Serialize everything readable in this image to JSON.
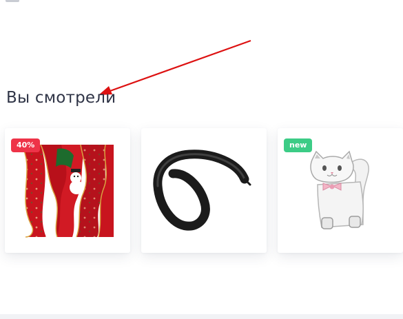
{
  "section": {
    "title": "Вы смотрели"
  },
  "products": [
    {
      "image": "red-christmas-ribbon",
      "badge": "40%",
      "badge_color": "#ee3348"
    },
    {
      "image": "black-modelling-balloon",
      "badge": null
    },
    {
      "image": "white-cat-gift-box",
      "badge": "new",
      "badge_color": "#3ccc86"
    }
  ],
  "annotation": {
    "type": "arrow",
    "color": "#dd1111",
    "points_to": "section-title"
  }
}
